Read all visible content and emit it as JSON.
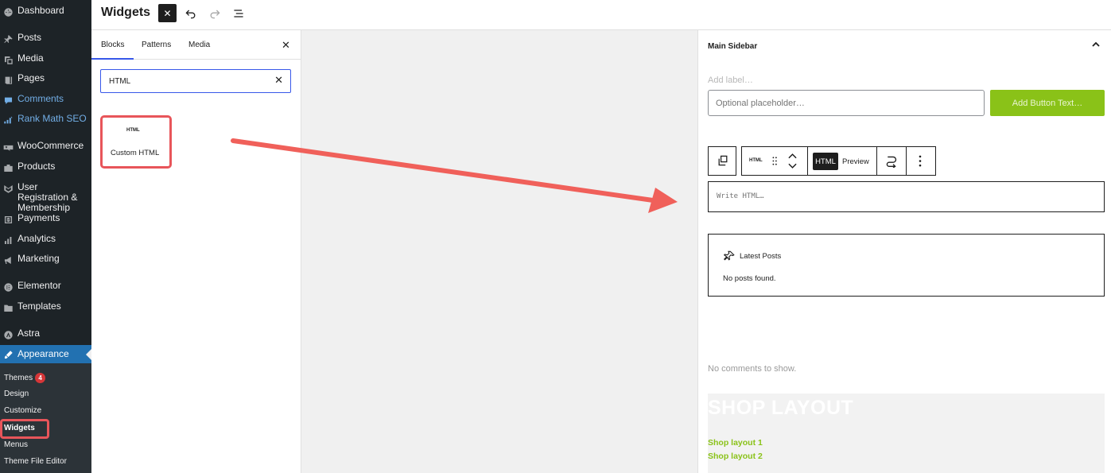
{
  "admin_menu": {
    "items": [
      {
        "label": "Dashboard",
        "icon": "dashboard-icon"
      },
      {
        "label": "Posts",
        "icon": "pin-icon"
      },
      {
        "label": "Media",
        "icon": "media-icon"
      },
      {
        "label": "Pages",
        "icon": "pages-icon"
      },
      {
        "label": "Comments",
        "icon": "comments-icon"
      },
      {
        "label": "Rank Math SEO",
        "icon": "rank-math-icon"
      },
      {
        "label": "WooCommerce",
        "icon": "woocommerce-icon"
      },
      {
        "label": "Products",
        "icon": "products-icon"
      },
      {
        "label": "User Registration & Membership",
        "icon": "user-registration-icon"
      },
      {
        "label": "Payments",
        "icon": "payments-icon"
      },
      {
        "label": "Analytics",
        "icon": "analytics-icon"
      },
      {
        "label": "Marketing",
        "icon": "marketing-icon"
      },
      {
        "label": "Elementor",
        "icon": "elementor-icon"
      },
      {
        "label": "Templates",
        "icon": "folder-icon"
      },
      {
        "label": "Astra",
        "icon": "astra-icon"
      },
      {
        "label": "Appearance",
        "icon": "appearance-icon"
      }
    ],
    "submenu": [
      {
        "label": "Themes",
        "badge": "4"
      },
      {
        "label": "Design"
      },
      {
        "label": "Customize"
      },
      {
        "label": "Widgets"
      },
      {
        "label": "Menus"
      },
      {
        "label": "Theme File Editor"
      }
    ]
  },
  "header": {
    "title": "Widgets",
    "close_icon": "close-icon",
    "undo_icon": "undo-icon",
    "redo_icon": "redo-icon",
    "list_view_icon": "list-view-icon"
  },
  "inserter": {
    "tabs": [
      "Blocks",
      "Patterns",
      "Media"
    ],
    "search_value": "HTML",
    "block": {
      "icon_text": "HTML",
      "label": "Custom HTML"
    }
  },
  "widget_area": {
    "title": "Main Sidebar",
    "form": {
      "label_placeholder": "Add label…",
      "input_placeholder": "Optional placeholder…",
      "button_text": "Add Button Text…"
    },
    "toolbar": {
      "block_icon_text": "HTML",
      "html_tab": "HTML",
      "preview_tab": "Preview"
    },
    "html_editor_placeholder": "Write HTML…",
    "latest_posts": {
      "title": "Latest Posts",
      "empty_text": "No posts found."
    },
    "no_comments": "No comments to show.",
    "shop": {
      "title": "SHOP LAYOUT",
      "links": [
        "Shop layout 1",
        "Shop layout 2"
      ]
    }
  },
  "colors": {
    "admin_bg": "#1d2327",
    "admin_current": "#2271b1",
    "accent_blue": "#3858e9",
    "highlight_red": "#e8555a",
    "brand_green": "#8ac218"
  }
}
